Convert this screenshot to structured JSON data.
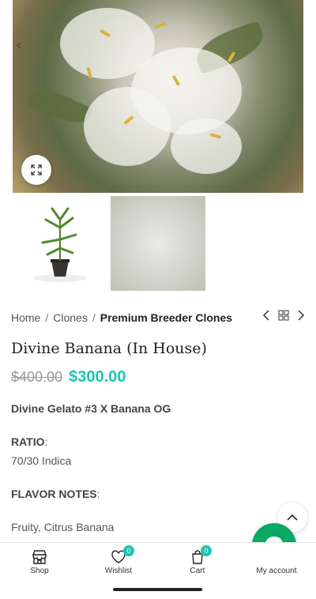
{
  "product": {
    "breadcrumb": {
      "home": "Home",
      "sep1": "/",
      "clones": "Clones",
      "sep2": "/",
      "current": "Premium Breeder Clones"
    },
    "title": "Divine Banana (In House)",
    "old_price": "$400.00",
    "new_price": "$300.00",
    "lineage": "Divine Gelato #3 X Banana OG",
    "ratio_label": "RATIO",
    "ratio_colon": ":",
    "ratio_value": "70/30 Indica",
    "flavor_label": "FLAVOR NOTES",
    "flavor_colon": ":",
    "flavor_value": "Fruity, Citrus Banana"
  },
  "bottom_nav": {
    "items": [
      {
        "label": "Shop",
        "icon": "store-icon"
      },
      {
        "label": "Wishlist",
        "icon": "heart-icon",
        "badge": "0"
      },
      {
        "label": "Cart",
        "icon": "bag-icon",
        "badge": "0"
      },
      {
        "label": "My account",
        "icon": "user-icon"
      }
    ]
  },
  "colors": {
    "accent": "#1bc6b4",
    "chat": "#0aa862"
  }
}
